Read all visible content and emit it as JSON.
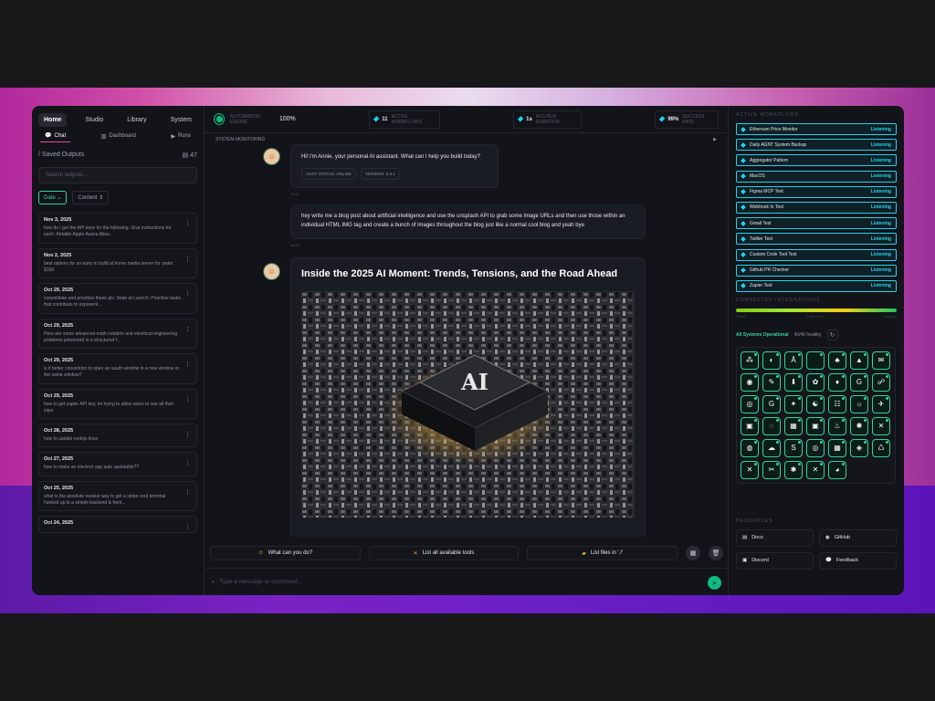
{
  "nav": {
    "tabs": [
      "Home",
      "Studio",
      "Library",
      "System"
    ],
    "active_tab": "Home"
  },
  "subnav": {
    "tabs": [
      "Chat",
      "Dashboard",
      "Runs"
    ],
    "active": "Chat"
  },
  "saved": {
    "title": "/ Saved Outputs",
    "count": "47",
    "search_placeholder": "Search outputs...",
    "filter_date": "Date",
    "filter_content": "Content"
  },
  "outputs": [
    {
      "date": "Nov 3, 2025",
      "text": "how do i get the API keys for the following. Give instructions for each: Airtable Apple Asana Atlas..."
    },
    {
      "date": "Nov 2, 2025",
      "text": "best options for an easy to build at home media server for under $150"
    },
    {
      "date": "Oct 29, 2025",
      "text": "consolidate and prioritize these pls: State at Launch: Prioritize tasks that contribute to exponent..."
    },
    {
      "date": "Oct 29, 2025",
      "text": "Here are some advanced math notation and electrical engineering problems presented in a structured f..."
    },
    {
      "date": "Oct 29, 2025",
      "text": "is it better convention to open an oauth window in a new window or the same window?"
    },
    {
      "date": "Oct 29, 2025",
      "text": "how to get zapier API key, im trying to allow users to see all their zaps"
    },
    {
      "date": "Oct 28, 2025",
      "text": "how to update nodejs linux"
    },
    {
      "date": "Oct 27, 2025",
      "text": "how to make an electron app auto updatable??"
    },
    {
      "date": "Oct 25, 2025",
      "text": "what is the absolute easiest way to get a stripe cmd terminal hooked up to a simple backend & front..."
    },
    {
      "date": "Oct 24, 2025",
      "text": ""
    }
  ],
  "topbar": {
    "engine_label": "AUTOMATION ENGINE",
    "engine_value": "100%",
    "workflows_value": "11",
    "workflows_label": "ACTIVE WORKFLOWS",
    "duration_value": "1s",
    "duration_label": "AVG RUN DURATION",
    "success_value": "99%",
    "success_label": "SUCCESS RATE",
    "monitoring": "SYSTEM MONITORING"
  },
  "chat": {
    "greeting": "Hi! I'm Annie, your personal AI assistant. What can I help you build today?",
    "chip_status": "AGNT STATUS: ONLINE",
    "chip_version": "VERSION: 0.3.1",
    "time1": "16:41",
    "user_msg": "hey write me a blog post about artificial intelligence and use the unsplash API to grab some image URLs and then use those within an individual HTML IMG tag and create a bunch of images throughout the blog just like a normal cool blog and yeah bye",
    "time2": "16:41",
    "post_title": "Inside the 2025 AI Moment: Trends, Tensions, and the Road Ahead",
    "hero_chip_text": "AI"
  },
  "suggestions": [
    "What can you do?",
    "List all available tools",
    "List files in './'"
  ],
  "input_placeholder": "Type a message or command...",
  "active_workflows": {
    "title": "ACTIVE WORKFLOWS",
    "items": [
      {
        "name": "Ethereum Price Monitor",
        "status": "Listening"
      },
      {
        "name": "Daily AGNT System Backup",
        "status": "Listening"
      },
      {
        "name": "Aggregator Pattern",
        "status": "Listening"
      },
      {
        "name": "MacOS",
        "status": "Listening"
      },
      {
        "name": "Figma MCP Test",
        "status": "Listening"
      },
      {
        "name": "Webhook In Test",
        "status": "Listening"
      },
      {
        "name": "Gmail Test",
        "status": "Listening"
      },
      {
        "name": "Twitter Test",
        "status": "Listening"
      },
      {
        "name": "Custom Code Tool Test",
        "status": "Listening"
      },
      {
        "name": "Github PR Checker",
        "status": "Listening"
      },
      {
        "name": "Zapier Test",
        "status": "Listening"
      }
    ]
  },
  "integrations": {
    "title": "CONNECTED INTEGRATIONS",
    "bar_labels": [
      "Failed",
      "Degraded",
      "Healthy"
    ],
    "health_fraction": 1.0,
    "status": "All Systems Operational",
    "healthy": "40/40 healthy",
    "icons": [
      "⁂",
      "◐",
      "Ā",
      "",
      "♣",
      "▲",
      "✉",
      "◉",
      "✎",
      "⬇",
      "✿",
      "♦",
      "G",
      "☍",
      "◎",
      "G",
      "✦",
      "☯",
      "☷",
      "☼",
      "✈",
      "▣",
      "◌",
      "▦",
      "▣",
      "♨",
      "✺",
      "✕",
      "◍",
      "☁",
      "S",
      "◎",
      "▦",
      "◈",
      "♺",
      "✕",
      "✂",
      "✱",
      "✕",
      "◕"
    ]
  },
  "resources": {
    "title": "RESOURCES",
    "items": [
      "Docs",
      "GitHub",
      "Discord",
      "Feedback"
    ]
  },
  "colors": {
    "accent_cyan": "#22d3ee",
    "accent_green": "#34d399",
    "pink": "#ec4899"
  }
}
